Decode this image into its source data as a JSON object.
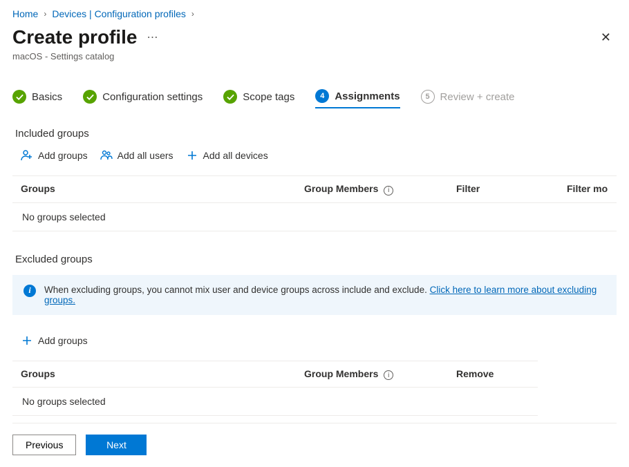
{
  "breadcrumb": {
    "home": "Home",
    "devices": "Devices | Configuration profiles"
  },
  "header": {
    "title": "Create profile",
    "subtitle": "macOS - Settings catalog"
  },
  "steps": {
    "basics": "Basics",
    "config": "Configuration settings",
    "scope": "Scope tags",
    "assignments": "Assignments",
    "assignments_num": "4",
    "review": "Review + create",
    "review_num": "5"
  },
  "included": {
    "title": "Included groups",
    "actions": {
      "add_groups": "Add groups",
      "add_all_users": "Add all users",
      "add_all_devices": "Add all devices"
    },
    "cols": {
      "groups": "Groups",
      "members": "Group Members",
      "filter": "Filter",
      "filter_mode": "Filter mo"
    },
    "empty": "No groups selected"
  },
  "excluded": {
    "title": "Excluded groups",
    "banner_text": "When excluding groups, you cannot mix user and device groups across include and exclude. ",
    "banner_link": "Click here to learn more about excluding groups.",
    "actions": {
      "add_groups": "Add groups"
    },
    "cols": {
      "groups": "Groups",
      "members": "Group Members",
      "remove": "Remove"
    },
    "empty": "No groups selected"
  },
  "footer": {
    "previous": "Previous",
    "next": "Next"
  }
}
